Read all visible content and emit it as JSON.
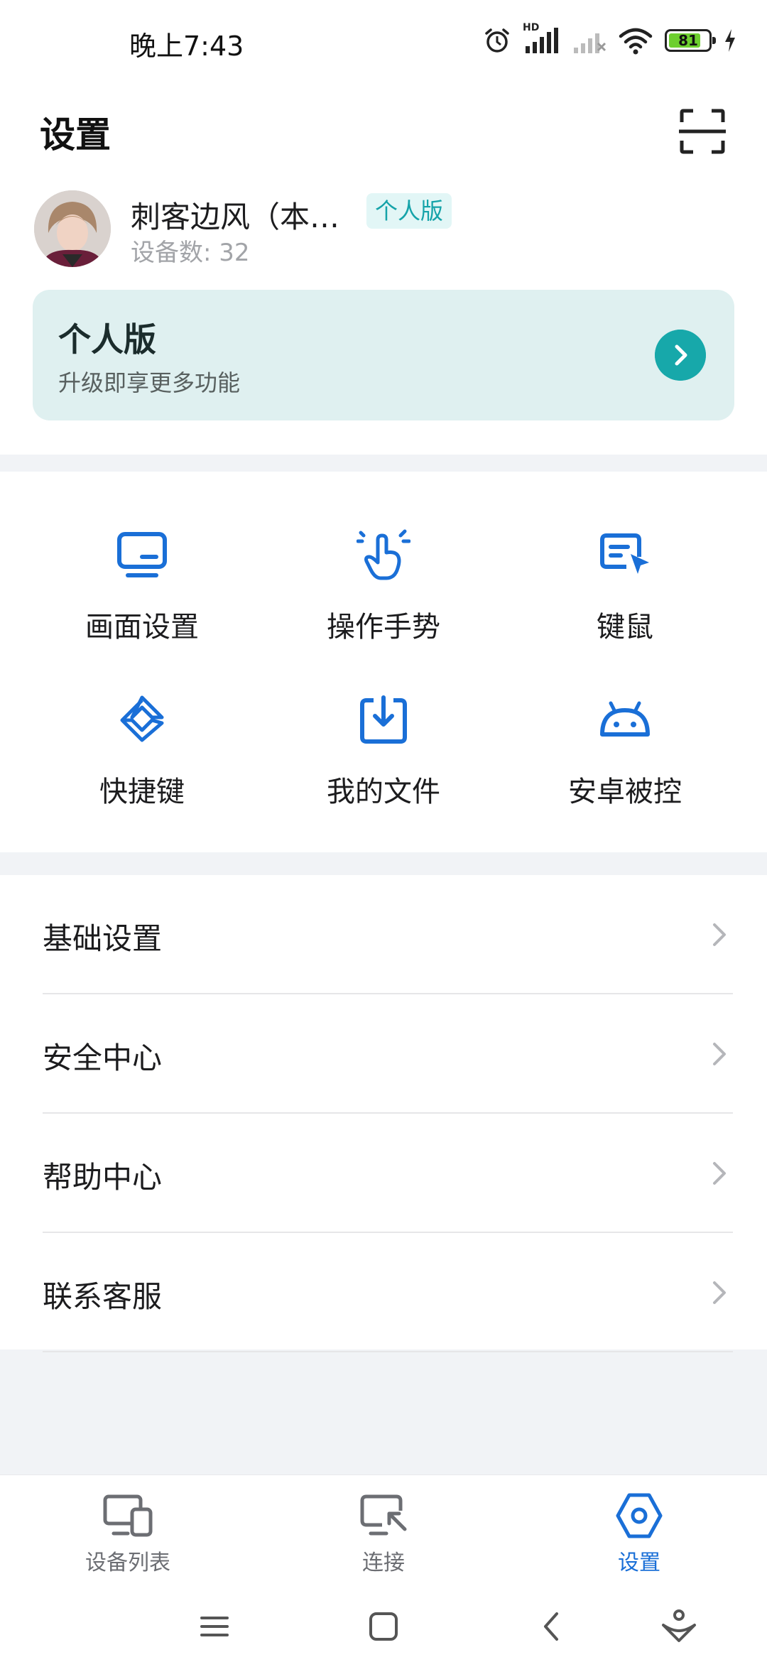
{
  "status_bar": {
    "time": "晚上7:43",
    "network_label": "HD",
    "battery": "81",
    "battery_level": 81
  },
  "header": {
    "title": "设置",
    "scan_icon": "scan-icon"
  },
  "profile": {
    "name": "刺客边风（本…",
    "badge": "个人版",
    "device_count": "设备数: 32"
  },
  "upgrade": {
    "title": "个人版",
    "subtitle": "升级即享更多功能"
  },
  "grid": [
    {
      "label": "画面设置",
      "icon": "display-icon"
    },
    {
      "label": "操作手势",
      "icon": "gesture-icon"
    },
    {
      "label": "键鼠",
      "icon": "keyboard-mouse-icon"
    },
    {
      "label": "快捷键",
      "icon": "shortcut-icon"
    },
    {
      "label": "我的文件",
      "icon": "file-download-icon"
    },
    {
      "label": "安卓被控",
      "icon": "android-icon"
    }
  ],
  "menu": [
    {
      "label": "基础设置"
    },
    {
      "label": "安全中心"
    },
    {
      "label": "帮助中心"
    },
    {
      "label": "联系客服"
    }
  ],
  "tabs": [
    {
      "label": "设备列表",
      "icon": "devices-icon",
      "active": false
    },
    {
      "label": "连接",
      "icon": "connect-icon",
      "active": false
    },
    {
      "label": "设置",
      "icon": "settings-icon",
      "active": true
    }
  ],
  "colors": {
    "accent_blue": "#1a6fd7",
    "teal": "#17a8aa",
    "card_bg": "#dff0f0"
  }
}
